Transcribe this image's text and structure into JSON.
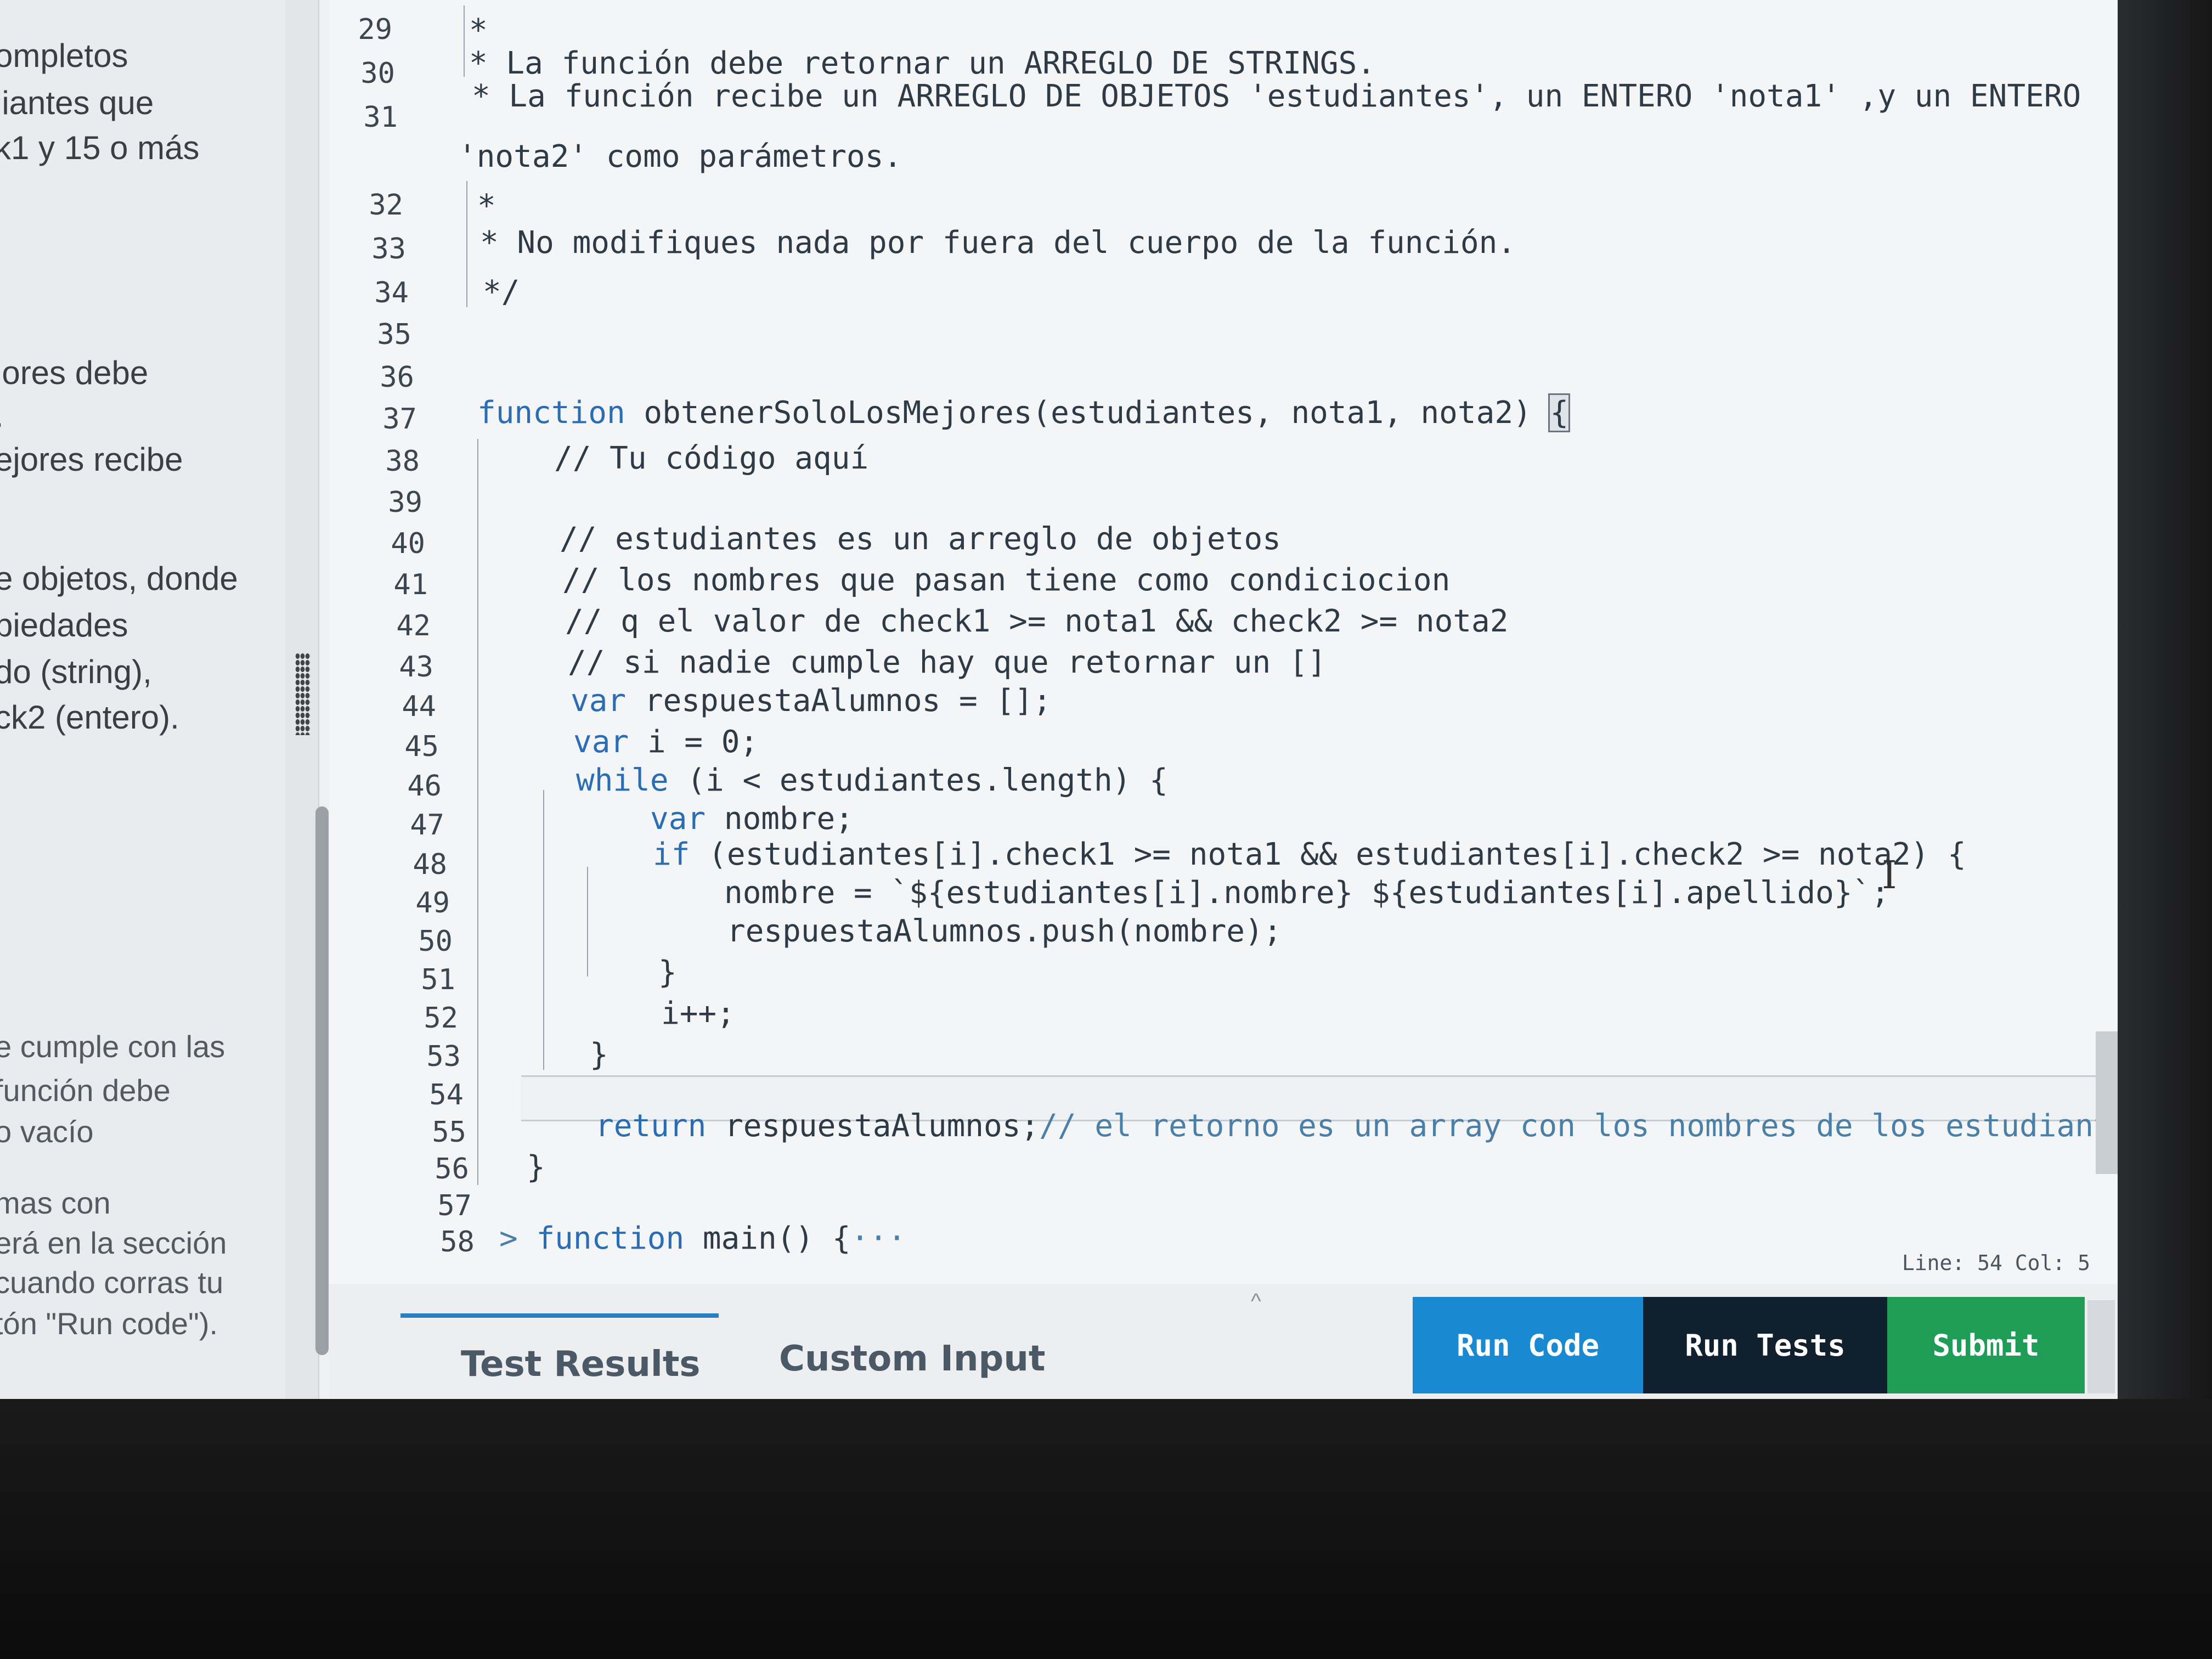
{
  "instructions": {
    "lines": [
      "ompletos",
      "liantes que",
      "k1 y 15 o más",
      "jores debe",
      ".",
      "ejores recibe",
      "e objetos, donde",
      "piedades",
      "do (string),",
      "ck2 (entero).",
      "e cumple con las",
      "función debe",
      "o vacío",
      "mas con",
      "erá en la sección",
      "cuando corras tu",
      "tón \"Run code\")."
    ]
  },
  "editor": {
    "line_numbers": [
      "29",
      "30",
      "31",
      "32",
      "33",
      "34",
      "35",
      "36",
      "37",
      "38",
      "39",
      "40",
      "41",
      "42",
      "43",
      "44",
      "45",
      "46",
      "47",
      "48",
      "49",
      "50",
      "51",
      "52",
      "53",
      "54",
      "55",
      "56",
      "57",
      "58"
    ],
    "code": {
      "l29": "*",
      "l30": "* La función debe retornar un ARREGLO DE STRINGS.",
      "l31a": "* La función recibe un ARREGLO DE OBJETOS 'estudiantes', un ENTERO 'nota1' ,y un ENTERO",
      "l31b": "'nota2' como parámetros.",
      "l32": "*",
      "l33": "* No modifiques nada por fuera del cuerpo de la función.",
      "l34": "*/",
      "l37_kw": "function",
      "l37_rest": " obtenerSoloLosMejores(estudiantes, nota1, nota2) ",
      "l37_brace": "{",
      "l38": "// Tu código aquí",
      "l40": "// estudiantes es un arreglo de objetos",
      "l41": "// los nombres que pasan tiene como condiciocion",
      "l42": "// q el valor de check1 >= nota1 && check2 >= nota2",
      "l43": "// si nadie cumple hay que retornar un []",
      "l44_kw": "var",
      "l44_rest": " respuestaAlumnos = [];",
      "l45_kw": "var",
      "l45_rest": " i = 0;",
      "l46_kw": "while",
      "l46_rest": " (i < estudiantes.length) {",
      "l47_kw": "var",
      "l47_rest": " nombre;",
      "l48_kw": "if",
      "l48_rest": " (estudiantes[i].check1 >= nota1 && estudiantes[i].check2 >= nota2) {",
      "l49": "nombre = `${estudiantes[i].nombre} ${estudiantes[i].apellido}`;",
      "l50": "respuestaAlumnos.push(nombre);",
      "l51": "}",
      "l52": "i++;",
      "l53": "}",
      "l55_kw": "return",
      "l55_rest": " respuestaAlumnos;",
      "l55_comment": "// el retorno es un array con los nombres de los estudiantes",
      "l56": "}",
      "l58_arrow": ">",
      "l58_kw": "function",
      "l58_rest": " main() {",
      "l58_ellipsis": "···"
    },
    "status": "Line: 54 Col: 5"
  },
  "bottom": {
    "tabs": [
      "Test Results",
      "Custom Input"
    ],
    "active_tab": "Test Results",
    "buttons": {
      "run": "Run Code",
      "tests": "Run Tests",
      "submit": "Submit"
    }
  },
  "colors": {
    "run": "#1989d2",
    "tests": "#10202e",
    "submit": "#1f9c56",
    "keyword": "#2a6db5"
  }
}
